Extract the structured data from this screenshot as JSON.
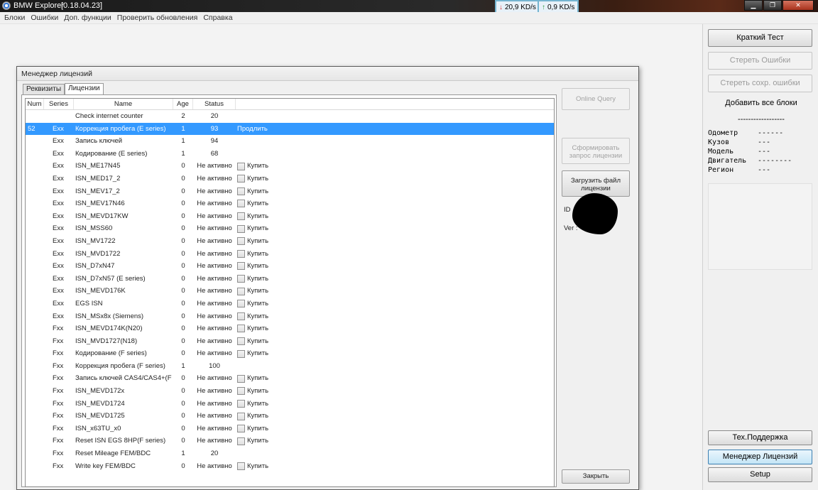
{
  "window": {
    "app_title": "BMW Explorer",
    "version": "[0.18.04.23]",
    "download_speed": "20,9 KD/s",
    "upload_speed": "0,9 KD/s"
  },
  "menu": [
    "Блоки",
    "Ошибки",
    "Доп. функции",
    "Проверить обновления",
    "Справка"
  ],
  "right_panel": {
    "quick_test": "Краткий Тест",
    "clear_errors": "Стереть Ошибки",
    "clear_saved_errors": "Стереть сохр. ошибки",
    "add_all_blocks": "Добавить все блоки",
    "separator": "------------------",
    "info": [
      {
        "label": "Одометр",
        "value": "------"
      },
      {
        "label": "Кузов",
        "value": "---"
      },
      {
        "label": "Модель",
        "value": "---"
      },
      {
        "label": "Двигатель",
        "value": "--------"
      },
      {
        "label": "Регион",
        "value": "---"
      }
    ],
    "tech_support": "Тех.Поддержка",
    "license_manager": "Менеджер Лицензий",
    "setup": "Setup"
  },
  "dialog": {
    "title": "Менеджер лицензий",
    "tabs": [
      "Реквизиты",
      "Лицензии"
    ],
    "columns": [
      "Num",
      "Series",
      "Name",
      "Age",
      "Status"
    ],
    "rows": [
      {
        "num": "",
        "series": "",
        "name": "Check internet counter",
        "age": "2",
        "status": "20",
        "extra": "",
        "checkbox": false
      },
      {
        "num": "52",
        "series": "Exx",
        "name": "Коррекция пробега (E series)",
        "age": "1",
        "status": "93",
        "extra": "Продлить",
        "checkbox": false
      },
      {
        "num": "",
        "series": "Exx",
        "name": "Запись ключей",
        "age": "1",
        "status": "94",
        "extra": "",
        "checkbox": false
      },
      {
        "num": "",
        "series": "Exx",
        "name": "Кодирование (E series)",
        "age": "1",
        "status": "68",
        "extra": "",
        "checkbox": false
      },
      {
        "num": "",
        "series": "Exx",
        "name": "ISN_ME17N45",
        "age": "0",
        "status": "Не активно",
        "extra": "Купить",
        "checkbox": true
      },
      {
        "num": "",
        "series": "Exx",
        "name": "ISN_MED17_2",
        "age": "0",
        "status": "Не активно",
        "extra": "Купить",
        "checkbox": true
      },
      {
        "num": "",
        "series": "Exx",
        "name": "ISN_MEV17_2",
        "age": "0",
        "status": "Не активно",
        "extra": "Купить",
        "checkbox": true
      },
      {
        "num": "",
        "series": "Exx",
        "name": "ISN_MEV17N46",
        "age": "0",
        "status": "Не активно",
        "extra": "Купить",
        "checkbox": true
      },
      {
        "num": "",
        "series": "Exx",
        "name": "ISN_MEVD17KW",
        "age": "0",
        "status": "Не активно",
        "extra": "Купить",
        "checkbox": true
      },
      {
        "num": "",
        "series": "Exx",
        "name": "ISN_MSS60",
        "age": "0",
        "status": "Не активно",
        "extra": "Купить",
        "checkbox": true
      },
      {
        "num": "",
        "series": "Exx",
        "name": "ISN_MV1722",
        "age": "0",
        "status": "Не активно",
        "extra": "Купить",
        "checkbox": true
      },
      {
        "num": "",
        "series": "Exx",
        "name": "ISN_MVD1722",
        "age": "0",
        "status": "Не активно",
        "extra": "Купить",
        "checkbox": true
      },
      {
        "num": "",
        "series": "Exx",
        "name": "ISN_D7xN47",
        "age": "0",
        "status": "Не активно",
        "extra": "Купить",
        "checkbox": true
      },
      {
        "num": "",
        "series": "Exx",
        "name": "ISN_D7xN57 (E series)",
        "age": "0",
        "status": "Не активно",
        "extra": "Купить",
        "checkbox": true
      },
      {
        "num": "",
        "series": "Exx",
        "name": "ISN_MEVD176K",
        "age": "0",
        "status": "Не активно",
        "extra": "Купить",
        "checkbox": true
      },
      {
        "num": "",
        "series": "Exx",
        "name": "EGS ISN",
        "age": "0",
        "status": "Не активно",
        "extra": "Купить",
        "checkbox": true
      },
      {
        "num": "",
        "series": "Exx",
        "name": "ISN_MSx8x (Siemens)",
        "age": "0",
        "status": "Не активно",
        "extra": "Купить",
        "checkbox": true
      },
      {
        "num": "",
        "series": "Fxx",
        "name": "ISN_MEVD174K(N20)",
        "age": "0",
        "status": "Не активно",
        "extra": "Купить",
        "checkbox": true
      },
      {
        "num": "",
        "series": "Fxx",
        "name": "ISN_MVD1727(N18)",
        "age": "0",
        "status": "Не активно",
        "extra": "Купить",
        "checkbox": true
      },
      {
        "num": "",
        "series": "Fxx",
        "name": "Кодирование (F series)",
        "age": "0",
        "status": "Не активно",
        "extra": "Купить",
        "checkbox": true
      },
      {
        "num": "",
        "series": "Fxx",
        "name": "Коррекция пробега (F series)",
        "age": "1",
        "status": "100",
        "extra": "",
        "checkbox": false
      },
      {
        "num": "",
        "series": "Fxx",
        "name": "Запись ключей CAS4/CAS4+(F",
        "age": "0",
        "status": "Не активно",
        "extra": "Купить",
        "checkbox": true
      },
      {
        "num": "",
        "series": "Fxx",
        "name": "ISN_MEVD172x",
        "age": "0",
        "status": "Не активно",
        "extra": "Купить",
        "checkbox": true
      },
      {
        "num": "",
        "series": "Fxx",
        "name": "ISN_MEVD1724",
        "age": "0",
        "status": "Не активно",
        "extra": "Купить",
        "checkbox": true
      },
      {
        "num": "",
        "series": "Fxx",
        "name": "ISN_MEVD1725",
        "age": "0",
        "status": "Не активно",
        "extra": "Купить",
        "checkbox": true
      },
      {
        "num": "",
        "series": "Fxx",
        "name": "ISN_x63TU_x0",
        "age": "0",
        "status": "Не активно",
        "extra": "Купить",
        "checkbox": true
      },
      {
        "num": "",
        "series": "Fxx",
        "name": "Reset ISN EGS 8HP(F series)",
        "age": "0",
        "status": "Не активно",
        "extra": "Купить",
        "checkbox": true
      },
      {
        "num": "",
        "series": "Fxx",
        "name": "Reset Mileage FEM/BDC",
        "age": "1",
        "status": "20",
        "extra": "",
        "checkbox": false
      },
      {
        "num": "",
        "series": "Fxx",
        "name": "Write key FEM/BDC",
        "age": "0",
        "status": "Не активно",
        "extra": "Купить",
        "checkbox": true
      }
    ],
    "selected_row": 1,
    "buttons": {
      "online_query": "Online Query",
      "form_request": "Сформировать запрос лицензии",
      "load_file": "Загрузить файл лицензии",
      "close": "Закрыть"
    },
    "id_label": "ID",
    "ver_label": "Ver :"
  }
}
